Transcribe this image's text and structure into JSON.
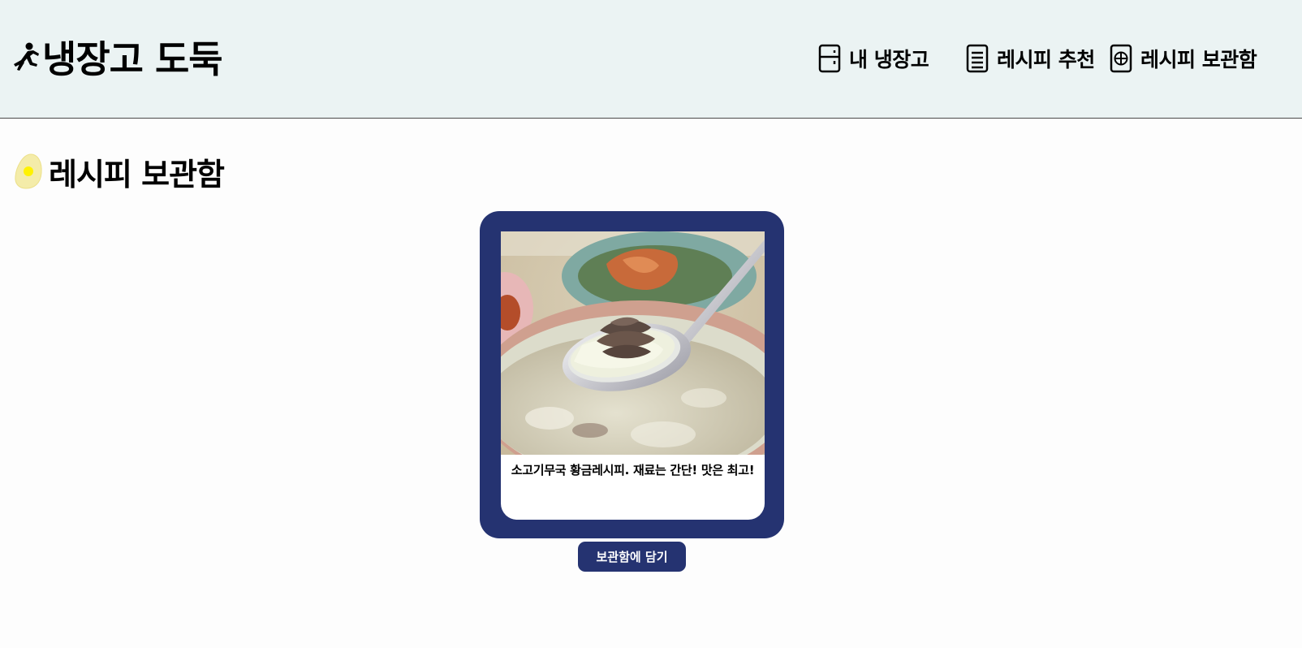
{
  "header": {
    "logo_text": "냉장고 도둑",
    "logo_icon": "running-person-icon",
    "nav": [
      {
        "label": "내 냉장고",
        "icon": "fridge-icon"
      },
      {
        "label": "레시피 추천",
        "icon": "document-icon"
      },
      {
        "label": "레시피 보관함",
        "icon": "plus-circle-box-icon"
      }
    ]
  },
  "page": {
    "title": "레시피 보관함",
    "title_icon": "egg-icon"
  },
  "recipes": [
    {
      "title": "소고기무국 황금레시피. 재료는 간단! 맛은 최고!",
      "image": "beef-radish-soup-photo",
      "button_label": "보관함에 담기"
    }
  ],
  "colors": {
    "header_bg": "#ebf3f3",
    "card_navy": "#253371",
    "page_bg": "#fdfdfd"
  }
}
